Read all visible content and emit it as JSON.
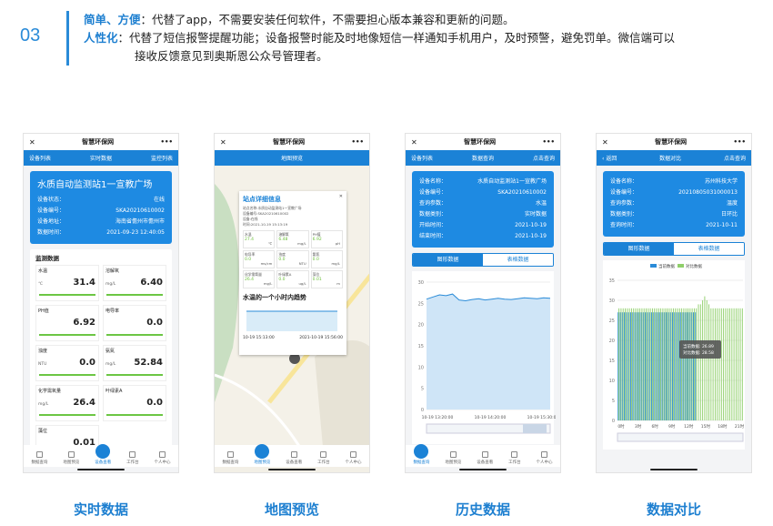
{
  "header": {
    "number": "03",
    "line1_bold": "简单、方便",
    "line1_text": "：代替了app，不需要安装任何软件，不需要担心版本兼容和更新的问题。",
    "line2_bold": "人性化",
    "line2_text": "：代替了短信报警提醒功能；设备报警时能及时地像短信一样通知手机用户，及时预警，避免罚单。微信端可以",
    "line3_text": "接收反馈意见到奥斯恩公众号管理者。"
  },
  "app_title": "智慧环保网",
  "bottom_nav": [
    "数据查询",
    "地图预览",
    "设备查看",
    "工作台",
    "个人中心"
  ],
  "screen1": {
    "caption": "实时数据",
    "tabs": [
      "设备列表",
      "实时数据",
      "监控列表"
    ],
    "station": "水质自动监测站1一宣教广场",
    "info": [
      {
        "k": "设备状态：",
        "v": "在线"
      },
      {
        "k": "设备编号：",
        "v": "SKA20210610002"
      },
      {
        "k": "设备地址：",
        "v": "海南省儋州市儋州市"
      },
      {
        "k": "数据时间：",
        "v": "2021-09-23 12:40:05"
      }
    ],
    "section_title": "监测数据",
    "metrics": [
      {
        "name": "水温",
        "unit": "℃",
        "value": "31.4"
      },
      {
        "name": "溶解氧",
        "unit": "mg/L",
        "value": "6.40"
      },
      {
        "name": "PH值",
        "unit": "",
        "value": "6.92"
      },
      {
        "name": "电导率",
        "unit": "",
        "value": "0.0"
      },
      {
        "name": "浊度",
        "unit": "NTU",
        "value": "0.0"
      },
      {
        "name": "氨氮",
        "unit": "mg/L",
        "value": "52.84"
      },
      {
        "name": "化学需氧量",
        "unit": "mg/L",
        "value": "26.4"
      },
      {
        "name": "叶绿素A",
        "unit": "",
        "value": "0.0"
      },
      {
        "name": "藻位",
        "unit": "",
        "value": "0.01"
      }
    ]
  },
  "screen2": {
    "caption": "地图预览",
    "tab_title": "地图预览",
    "popup_title": "站点详细信息",
    "popup_lines": [
      "站点名称:水质自动监测站1一宣教广场",
      "设备编号:SKA20210610002",
      "设备:在线",
      "时间:2021-10-19 15:13:19"
    ],
    "mini": [
      {
        "name": "水温",
        "value": "27.4",
        "unit": "℃"
      },
      {
        "name": "溶解氧",
        "value": "6.48",
        "unit": "mg/L"
      },
      {
        "name": "PH值",
        "value": "6.92",
        "unit": "pH"
      },
      {
        "name": "电导率",
        "value": "0.0",
        "unit": "ms/cm"
      },
      {
        "name": "浊度",
        "value": "0.0",
        "unit": "NTU"
      },
      {
        "name": "氨氮",
        "value": "0.0",
        "unit": "mg/L"
      },
      {
        "name": "化学需氧量",
        "value": "26.4",
        "unit": "mg/L"
      },
      {
        "name": "叶绿素A",
        "value": "0.0",
        "unit": "ug/L"
      },
      {
        "name": "藻位",
        "value": "0.01",
        "unit": "m"
      }
    ],
    "trend_title": "水温的一个小时内趋势",
    "trend_x": [
      "10-19 15:13:00",
      "2021-10-19 15:56:00"
    ]
  },
  "screen3": {
    "caption": "历史数据",
    "tabs": [
      "设备列表",
      "数据查询",
      "点击查询"
    ],
    "info": [
      {
        "k": "设备名称：",
        "v": "水质自动监测站1一宣教广场"
      },
      {
        "k": "设备编号：",
        "v": "SKA20210610002"
      },
      {
        "k": "查询参数：",
        "v": "水温"
      },
      {
        "k": "数据类别：",
        "v": "实时数据"
      },
      {
        "k": "开始时间：",
        "v": "2021-10-19"
      },
      {
        "k": "结束时间：",
        "v": "2021-10-19"
      }
    ],
    "seg": [
      "图形数据",
      "表格数据"
    ],
    "chart_data": {
      "type": "area",
      "yticks": [
        "30",
        "25",
        "20",
        "15",
        "10",
        "5",
        "0"
      ],
      "xticks": [
        "10-19 13:20:00",
        "10-19 14:20:00",
        "10-19 15:30:00"
      ],
      "ylim": [
        0,
        30
      ],
      "values": [
        26,
        26.5,
        27,
        26.8,
        27.2,
        25.8,
        25.6,
        25.9,
        26.1,
        25.8,
        26,
        26.2,
        26,
        25.9,
        26.1,
        26.3,
        26.2,
        26.1,
        26.3,
        26.2
      ]
    }
  },
  "screen4": {
    "caption": "数据对比",
    "tabs": [
      "返回",
      "数据对比",
      "点击查询"
    ],
    "info": [
      {
        "k": "设备名称：",
        "v": "苏州科技大学"
      },
      {
        "k": "设备编号：",
        "v": "20210805031000013"
      },
      {
        "k": "查询参数：",
        "v": "温度"
      },
      {
        "k": "数据类别：",
        "v": "日环比"
      },
      {
        "k": "查询时间：",
        "v": "2021-10-11"
      }
    ],
    "seg": [
      "图形数据",
      "表格数据"
    ],
    "legend": [
      "当前数据",
      "对比数据"
    ],
    "tooltip": [
      "当前数据: 26.89",
      "对比数据: 28.58"
    ],
    "chart_data": {
      "type": "bar",
      "yticks": [
        "35",
        "30",
        "25",
        "20",
        "15",
        "10",
        "5",
        "0"
      ],
      "xticks": [
        "0时",
        "3时",
        "6时",
        "9时",
        "12时",
        "15时",
        "18时",
        "21时"
      ],
      "ylim": [
        0,
        35
      ],
      "series": [
        {
          "name": "当前数据",
          "color": "#2a8bd8",
          "values": [
            27,
            27,
            27,
            27,
            27,
            27,
            27,
            27,
            27,
            27,
            27,
            27,
            27,
            27,
            27,
            27,
            27,
            27,
            27,
            27,
            27,
            27,
            27,
            27,
            27,
            27,
            27,
            27,
            27,
            27,
            27,
            27,
            27,
            27,
            27,
            27,
            27,
            27,
            0,
            0,
            0,
            0,
            0,
            0,
            0,
            0,
            0,
            0,
            0,
            0,
            0,
            0,
            0,
            0,
            0,
            0,
            0,
            0,
            0,
            0
          ]
        },
        {
          "name": "对比数据",
          "color": "#8fcf6a",
          "values": [
            28,
            28,
            28,
            28,
            28,
            28,
            28,
            28,
            28,
            28,
            28,
            28,
            28,
            28,
            28,
            28,
            28,
            28,
            28,
            28,
            28,
            28,
            28,
            28,
            28,
            28,
            28,
            28,
            28,
            28,
            28,
            28,
            28,
            28,
            28,
            28,
            28,
            28,
            29,
            29,
            30,
            31,
            30,
            29,
            28,
            28,
            28,
            28,
            28,
            28,
            28,
            28,
            28,
            28,
            28,
            28,
            28,
            28,
            28,
            28
          ]
        }
      ]
    }
  }
}
